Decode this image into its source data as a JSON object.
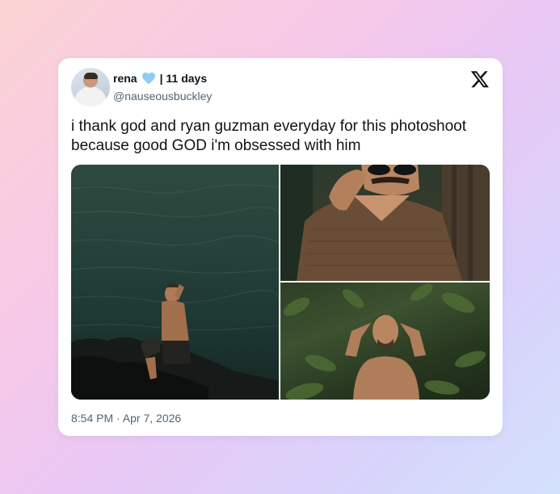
{
  "tweet": {
    "author_name": "rena",
    "separator": "|",
    "relative_time": "11 days",
    "handle": "@nauseousbuckley",
    "text_line1": "i thank god and ryan guzman everyday for this photoshoot",
    "text_line2": "because good GOD i'm obsessed with him",
    "timestamp": "8:54 PM · Apr 7, 2026"
  },
  "icons": {
    "verified": "blue-heart-icon",
    "platform": "x-logo-icon"
  },
  "colors": {
    "heart": "#8ecdf2",
    "text_primary": "#0f1419",
    "text_secondary": "#536471"
  },
  "media": [
    {
      "description_name": "photo-man-sitting-on-rocks-by-sea"
    },
    {
      "description_name": "photo-man-with-sunglasses-knit-shirt"
    },
    {
      "description_name": "photo-man-in-foliage"
    }
  ]
}
